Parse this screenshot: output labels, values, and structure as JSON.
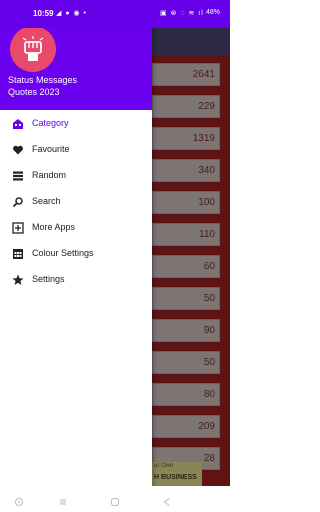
{
  "status_bar": {
    "time": "10:59",
    "left_icons": "◢ ● ◉ •",
    "right_icons": "▣ ⊗ ◌ ≋ ıl",
    "battery": "48%"
  },
  "app": {
    "name": "Status Messages",
    "subtitle": "Quotes 2023",
    "accent_color": "#6a00ee",
    "logo_color": "#ea4a6a"
  },
  "menu": {
    "items": [
      {
        "label": "Category",
        "icon": "category-icon",
        "active": true
      },
      {
        "label": "Favourite",
        "icon": "heart-icon",
        "active": false
      },
      {
        "label": "Random",
        "icon": "random-icon",
        "active": false
      },
      {
        "label": "Search",
        "icon": "search-icon",
        "active": false
      },
      {
        "label": "More Apps",
        "icon": "plus-box-icon",
        "active": false
      },
      {
        "label": "Colour Settings",
        "icon": "palette-icon",
        "active": false
      },
      {
        "label": "Settings",
        "icon": "star-icon",
        "active": false
      }
    ]
  },
  "background_list": {
    "counts": [
      "2641",
      "229",
      "1319",
      "340",
      "100",
      "110",
      "60",
      "50",
      "90",
      "50",
      "80",
      "209",
      "28"
    ]
  },
  "ad": {
    "line1": "ur Own",
    "line2": "H BUSINESS"
  }
}
